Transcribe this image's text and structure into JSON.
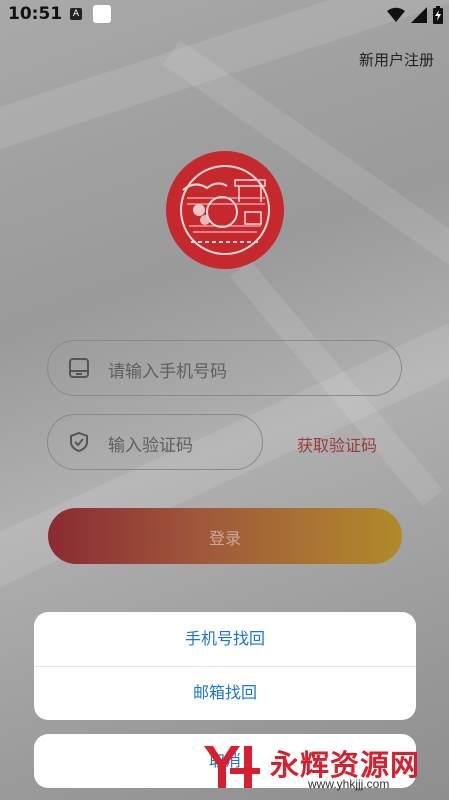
{
  "status_bar": {
    "time": "10:51",
    "icons": [
      "a-notification-icon",
      "app-notification-icon",
      "wifi-icon",
      "signal-icon",
      "battery-icon"
    ]
  },
  "header": {
    "register_label": "新用户注册"
  },
  "form": {
    "phone_placeholder": "请输入手机号码",
    "code_placeholder": "输入验证码",
    "get_code_label": "获取验证码",
    "login_label": "登录"
  },
  "action_sheet": {
    "options": [
      {
        "label": "手机号找回"
      },
      {
        "label": "邮箱找回"
      }
    ],
    "cancel_label": "取消"
  },
  "watermark": {
    "brand": "永辉资源网",
    "url": "www.yhkjjj.com"
  },
  "colors": {
    "accent_blue": "#1976d2",
    "get_code_red": "#9c3b3b",
    "logo_red": "#c5282d",
    "watermark_red": "#d6202f"
  }
}
